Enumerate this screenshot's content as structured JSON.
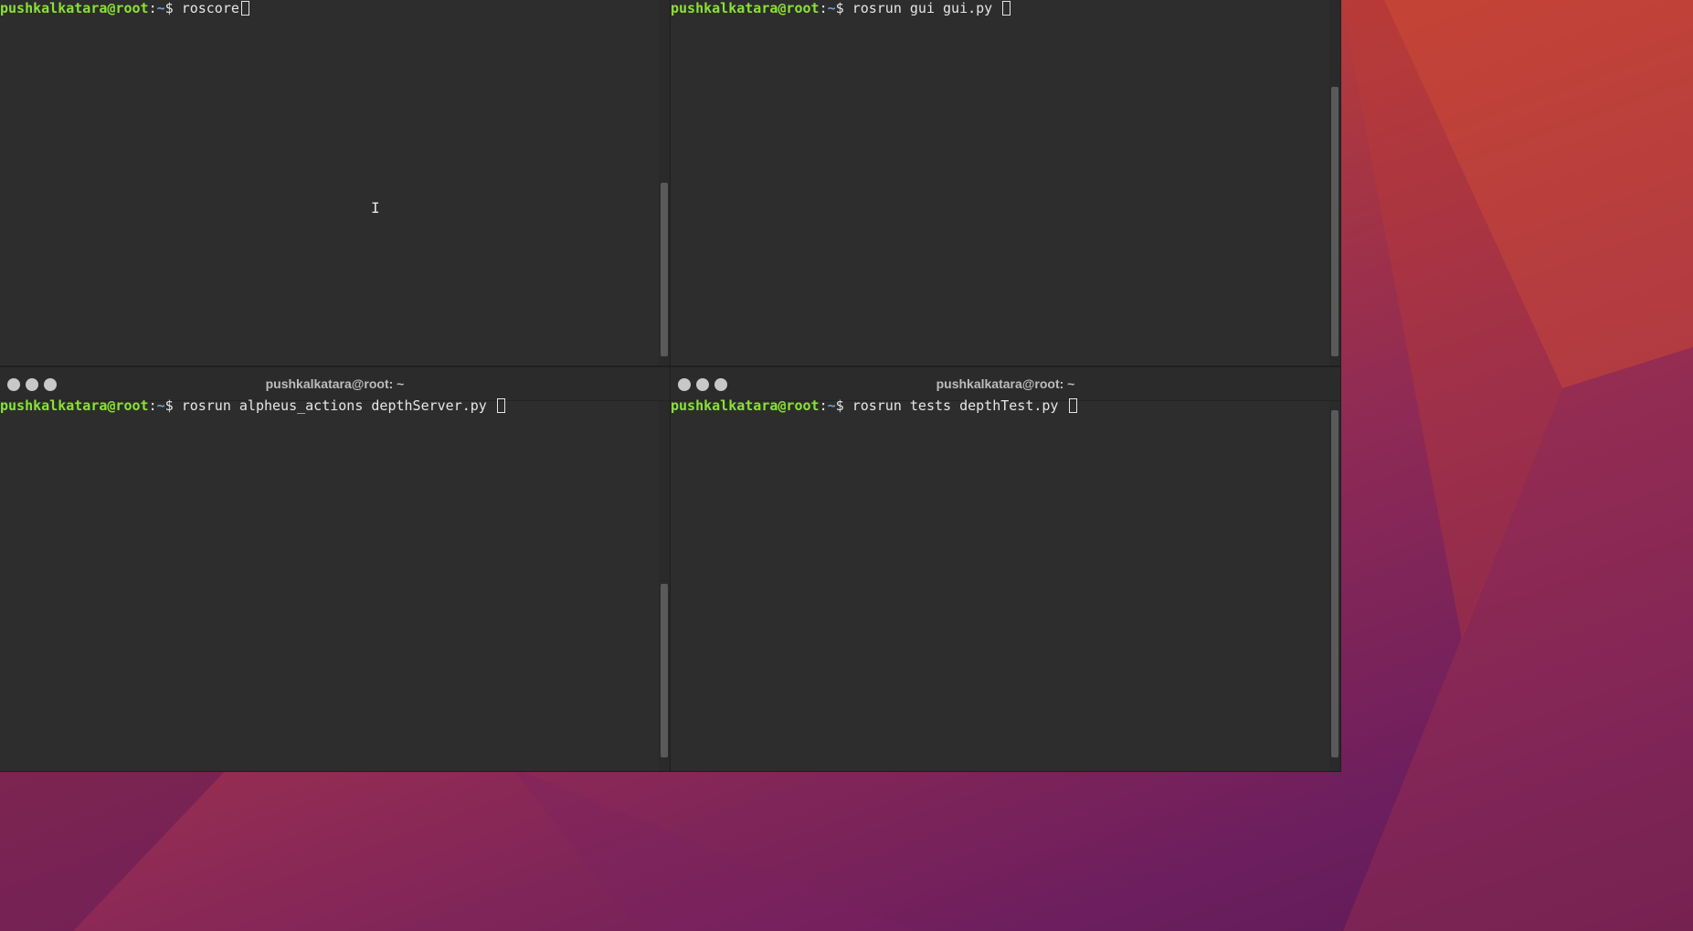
{
  "desktop": {
    "wallpaper_colors": [
      "#c74132",
      "#b13a3d",
      "#8e2a55",
      "#6c1e5e",
      "#5a1a54"
    ]
  },
  "terminals": [
    {
      "title": "",
      "prompt": {
        "user_host": "pushkalkatara@root",
        "separator": ":",
        "path": "~",
        "symbol": "$"
      },
      "command": "roscore",
      "scroll_fraction_visible": 0.5
    },
    {
      "title": "",
      "prompt": {
        "user_host": "pushkalkatara@root",
        "separator": ":",
        "path": "~",
        "symbol": "$"
      },
      "command": "rosrun gui gui.py",
      "scroll_fraction_visible": 0.75
    },
    {
      "title": "pushkalkatara@root: ~",
      "prompt": {
        "user_host": "pushkalkatara@root",
        "separator": ":",
        "path": "~",
        "symbol": "$"
      },
      "command": "rosrun alpheus_actions depthServer.py",
      "scroll_fraction_visible": 0.5
    },
    {
      "title": "pushkalkatara@root: ~",
      "prompt": {
        "user_host": "pushkalkatara@root",
        "separator": ":",
        "path": "~",
        "symbol": "$"
      },
      "command": "rosrun tests depthTest.py",
      "scroll_fraction_visible": 0.95
    }
  ],
  "icons": {
    "window_buttons": [
      "close-icon",
      "minimize-icon",
      "maximize-icon"
    ],
    "mouse_pointer": "ibeam-cursor-icon"
  }
}
